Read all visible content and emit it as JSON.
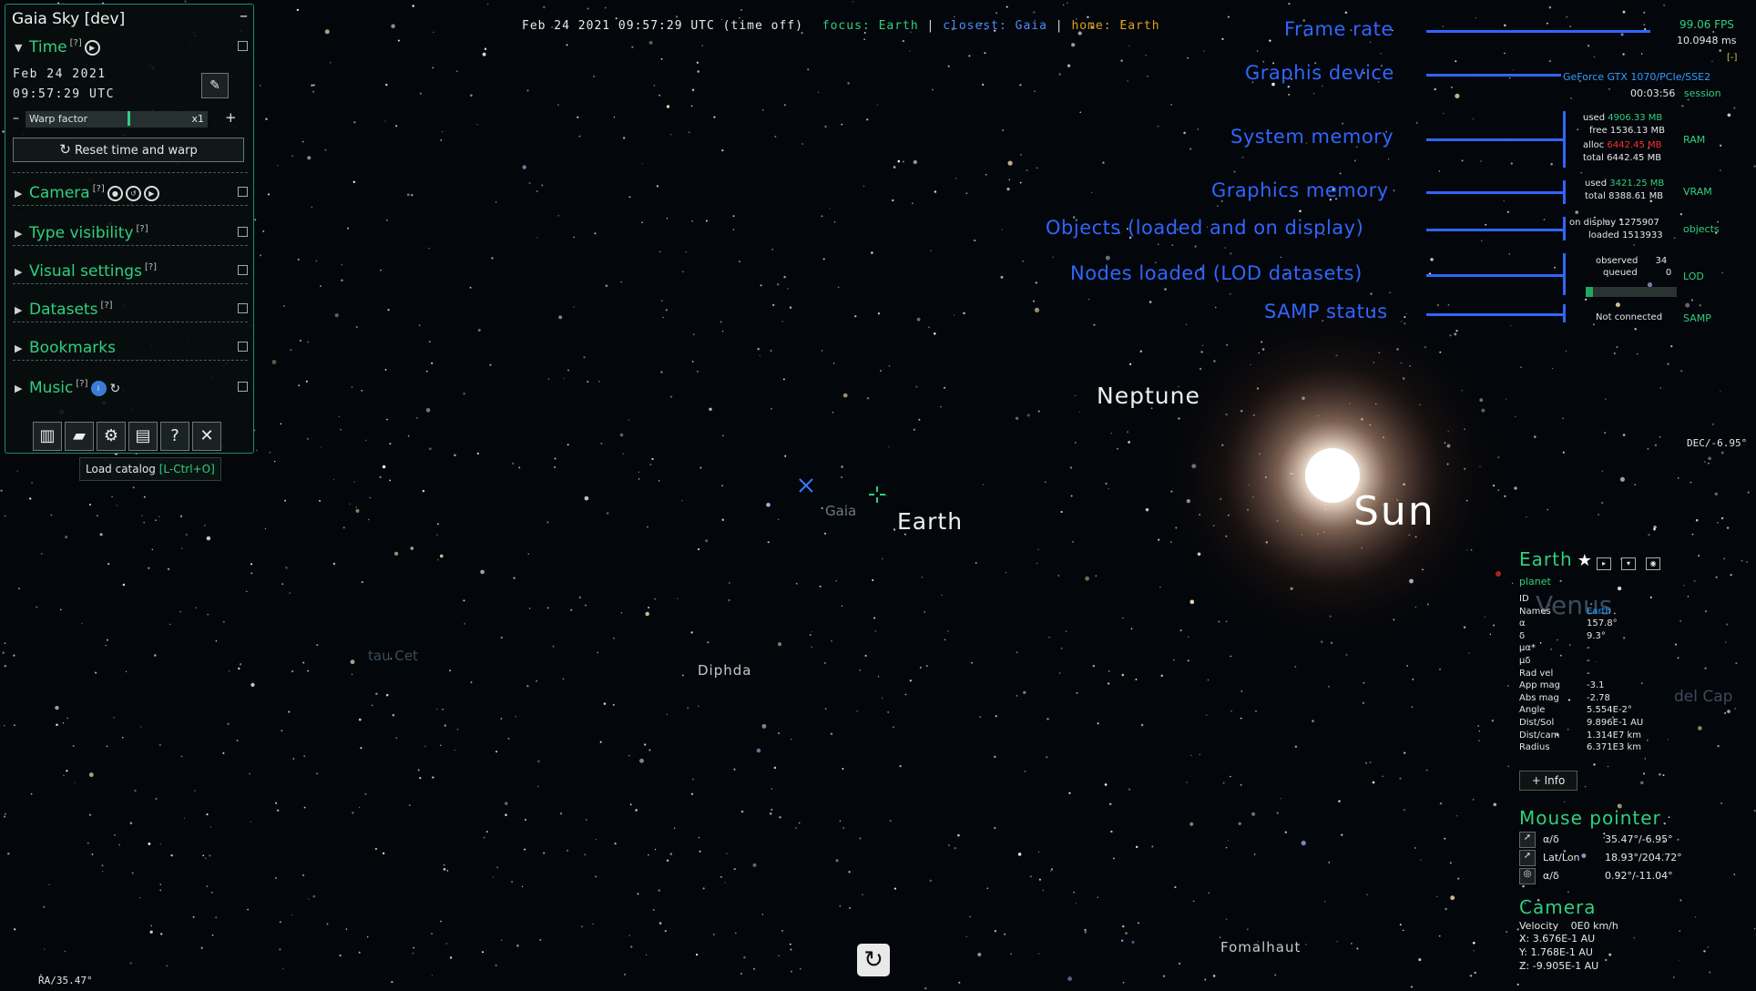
{
  "app": {
    "title": "Gaia Sky [dev]",
    "status_bar": {
      "datetime": "Feb 24 2021 09:57:29 UTC (time off)",
      "focus_label": "focus:",
      "focus_value": "Earth",
      "closest_label": "closest:",
      "closest_value": "Gaia",
      "home_label": "home:",
      "home_value": "Earth",
      "sep": "|"
    }
  },
  "panel": {
    "time": {
      "label": "Time",
      "hint": "[?]",
      "date": "Feb 24 2021",
      "time": "09:57:29 UTC",
      "warp_label": "Warp factor",
      "warp_value": "x1",
      "minus": "–",
      "plus": "+",
      "reset_label": "Reset time and warp"
    },
    "sections": [
      {
        "label": "Camera",
        "hint": "[?]"
      },
      {
        "label": "Type visibility",
        "hint": "[?]"
      },
      {
        "label": "Visual settings",
        "hint": "[?]"
      },
      {
        "label": "Datasets",
        "hint": "[?]"
      },
      {
        "label": "Bookmarks",
        "hint": ""
      },
      {
        "label": "Music",
        "hint": "[?]"
      }
    ],
    "toolbar_icons": [
      "map-icon",
      "folder-open-icon",
      "gear-icon",
      "log-icon",
      "help-icon",
      "close-icon"
    ],
    "tooltip": {
      "text": "Load catalog",
      "shortcut": "[L-Ctrl+O]"
    }
  },
  "sky_labels": {
    "neptune": "Neptune",
    "sun": "Sun",
    "earth": "Earth",
    "gaia": "Gaia",
    "diphda": "Diphda",
    "fomalhaut": "Fomalhaut",
    "tau_cet": "tau Cet",
    "venus": "Venus",
    "del_cap": "del Cap",
    "ra": "RA/35.47°",
    "dec": "DEC/-6.95°"
  },
  "callouts": {
    "frame_rate": "Frame rate",
    "graphics_device": "Graphis device",
    "system_memory": "System memory",
    "graphics_memory": "Graphics memory",
    "objects": "Objects (loaded and on display)",
    "nodes": "Nodes loaded (LOD datasets)",
    "samp": "SAMP status"
  },
  "stats": {
    "fps": "99.06 FPS",
    "ms": "10.0948 ms",
    "collapse": "[-]",
    "device": "GeForce GTX 1070/PCIe/SSE2",
    "session_time": "00:03:56",
    "session_label": "session",
    "ram": {
      "used_label": "used",
      "used": "4906.33 MB",
      "free_label": "free",
      "free": "1536.13 MB",
      "alloc_label": "alloc",
      "alloc": "6442.45 MB",
      "total_label": "total",
      "total": "6442.45 MB",
      "tag": "RAM"
    },
    "vram": {
      "used_label": "used",
      "used": "3421.25 MB",
      "total_label": "total",
      "total": "8388.61 MB",
      "tag": "VRAM"
    },
    "objects": {
      "display_label": "on display",
      "display": "1275907",
      "loaded_label": "loaded",
      "loaded": "1513933",
      "tag": "objects"
    },
    "lod": {
      "observed_label": "observed",
      "observed": "34",
      "queued_label": "queued",
      "queued": "0",
      "tag": "LOD",
      "progress": 0.08
    },
    "samp": {
      "status": "Not connected",
      "tag": "SAMP"
    }
  },
  "focus_info": {
    "name": "Earth",
    "type": "planet",
    "rows": [
      {
        "k": "ID",
        "v": ""
      },
      {
        "k": "Names",
        "v": "Earth"
      },
      {
        "k": "α",
        "v": "157.8°"
      },
      {
        "k": "δ",
        "v": "9.3°"
      },
      {
        "k": "μα*",
        "v": "-"
      },
      {
        "k": "μδ",
        "v": "-"
      },
      {
        "k": "Rad vel",
        "v": "-"
      },
      {
        "k": "App mag",
        "v": "-3.1"
      },
      {
        "k": "Abs mag",
        "v": "-2.78"
      },
      {
        "k": "Angle",
        "v": "5.554E-2°"
      },
      {
        "k": "Dist/Sol",
        "v": "9.896E-1 AU"
      },
      {
        "k": "Dist/cam",
        "v": "1.314E7 km"
      },
      {
        "k": "Radius",
        "v": "6.371E3 km"
      }
    ],
    "info_button": "+ Info"
  },
  "mouse_pointer": {
    "title": "Mouse pointer",
    "rows": [
      {
        "k": "α/δ",
        "v": "35.47°/-6.95°"
      },
      {
        "k": "Lat/Lon",
        "v": "18.93°/204.72°"
      },
      {
        "k": "α/δ",
        "v": "0.92°/-11.04°"
      }
    ]
  },
  "camera_info": {
    "title": "Camera",
    "velocity_label": "Velocity",
    "velocity": "0E0 km/h",
    "x": "X: 3.676E-1 AU",
    "y": "Y: 1.768E-1 AU",
    "z": "Z: -9.905E-1 AU"
  },
  "colors": {
    "accent": "#2fd07f",
    "callout": "#2f66ff",
    "closest": "#4a8cff",
    "home": "#e0a020"
  }
}
